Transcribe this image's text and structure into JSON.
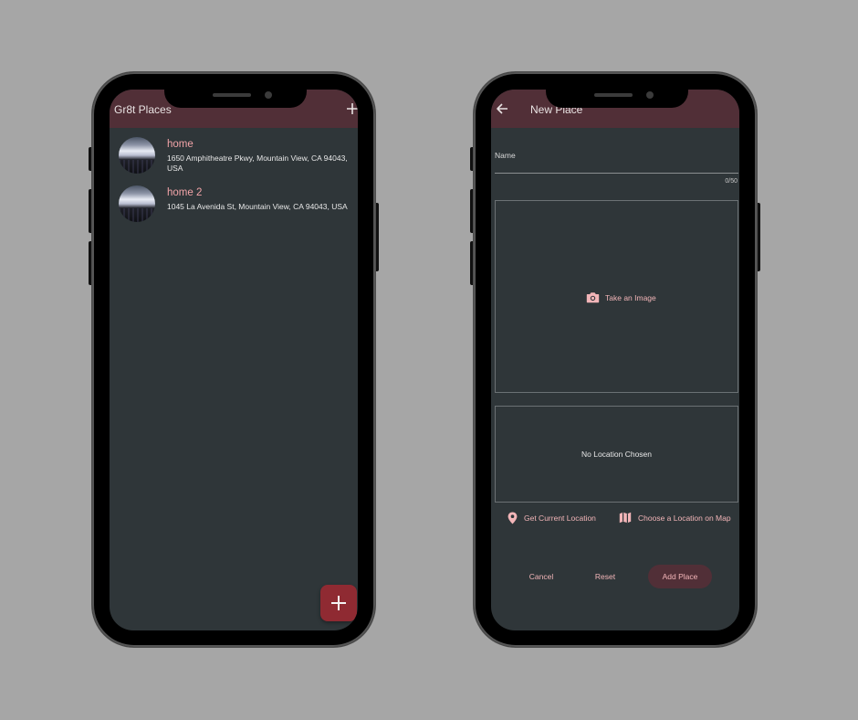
{
  "left_screen": {
    "title": "Gr8t Places",
    "add_icon": "plus-icon",
    "places": [
      {
        "title": "home",
        "address": "1650 Amphitheatre Pkwy, Mountain View, CA 94043, USA"
      },
      {
        "title": "home 2",
        "address": "1045 La Avenida St, Mountain View, CA 94043, USA"
      }
    ],
    "fab_icon": "plus-icon"
  },
  "right_screen": {
    "title": "New Place",
    "back_icon": "arrow-left-icon",
    "name_field": {
      "label": "Name",
      "value": "",
      "counter": "0/50"
    },
    "image_preview": {
      "icon": "camera-icon",
      "label": "Take an Image"
    },
    "location_preview": {
      "text": "No Location Chosen"
    },
    "location_actions": {
      "current": {
        "icon": "location-pin-icon",
        "label": "Get Current Location"
      },
      "map": {
        "icon": "map-icon",
        "label": "Choose a Location on Map"
      }
    },
    "buttons": {
      "cancel": "Cancel",
      "reset": "Reset",
      "add": "Add Place"
    }
  },
  "colors": {
    "background": "#a6a6a6",
    "screen": "#2f3639",
    "appbar": "#512f37",
    "accent": "#f2b5b8",
    "fab": "#8f2a32"
  }
}
